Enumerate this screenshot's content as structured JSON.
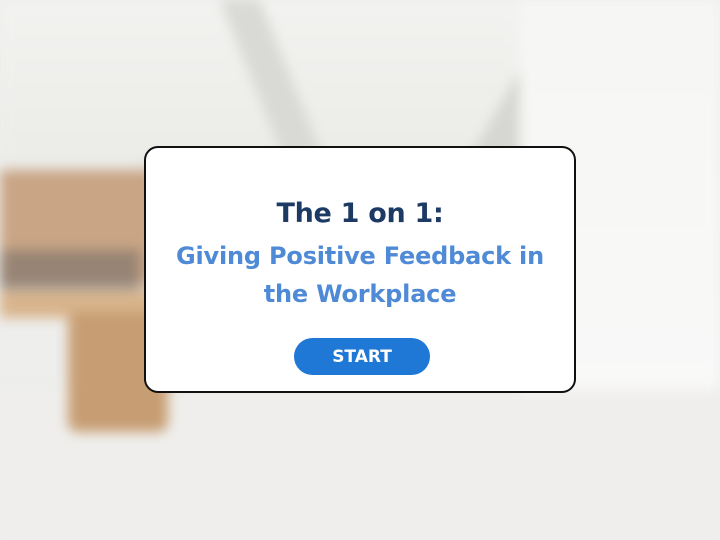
{
  "card": {
    "title": "The 1 on 1:",
    "subtitle": "Giving Positive Feedback in the Workplace",
    "start_label": "START"
  },
  "colors": {
    "title": "#1d3a64",
    "subtitle": "#4f8ad6",
    "button": "#1f78d6",
    "card_border": "#111111"
  }
}
